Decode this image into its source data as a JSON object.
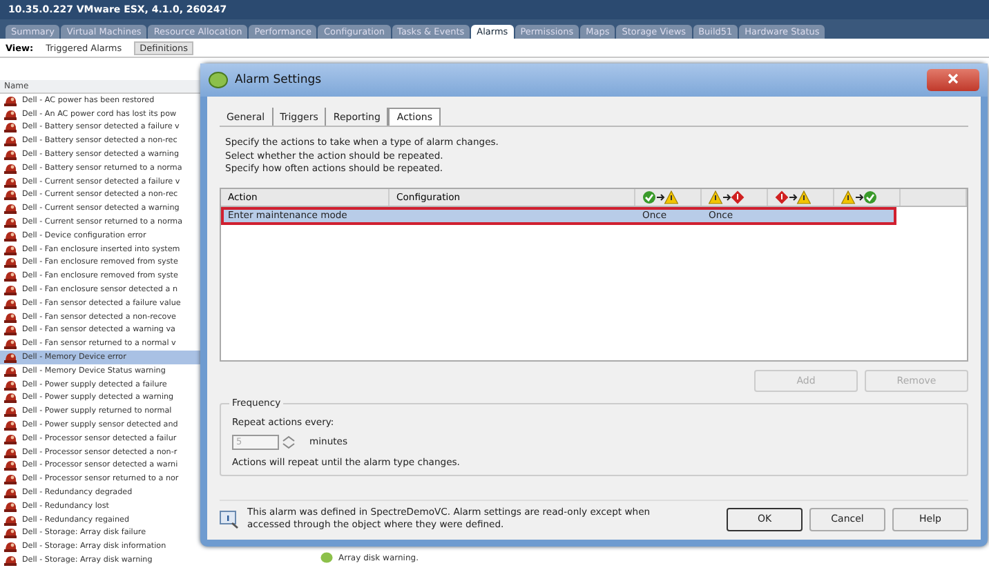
{
  "window": {
    "title": "10.35.0.227 VMware ESX, 4.1.0, 260247"
  },
  "tabs": [
    {
      "label": "Summary",
      "selected": false
    },
    {
      "label": "Virtual Machines",
      "selected": false
    },
    {
      "label": "Resource Allocation",
      "selected": false
    },
    {
      "label": "Performance",
      "selected": false
    },
    {
      "label": "Configuration",
      "selected": false
    },
    {
      "label": "Tasks & Events",
      "selected": false
    },
    {
      "label": "Alarms",
      "selected": true
    },
    {
      "label": "Permissions",
      "selected": false
    },
    {
      "label": "Maps",
      "selected": false
    },
    {
      "label": "Storage Views",
      "selected": false
    },
    {
      "label": "Build51",
      "selected": false
    },
    {
      "label": "Hardware Status",
      "selected": false
    }
  ],
  "view": {
    "label": "View:",
    "options": [
      {
        "label": "Triggered Alarms",
        "selected": false
      },
      {
        "label": "Definitions",
        "selected": true
      }
    ]
  },
  "alarm_list": {
    "column": "Name",
    "items": [
      {
        "name": "Dell - AC power has been restored",
        "selected": false
      },
      {
        "name": "Dell - An AC power cord has lost its pow",
        "selected": false
      },
      {
        "name": "Dell - Battery sensor detected a failure v",
        "selected": false
      },
      {
        "name": "Dell - Battery sensor detected a non-rec",
        "selected": false
      },
      {
        "name": "Dell - Battery sensor detected a warning",
        "selected": false
      },
      {
        "name": "Dell - Battery sensor returned to a norma",
        "selected": false
      },
      {
        "name": "Dell - Current sensor detected a failure v",
        "selected": false
      },
      {
        "name": "Dell - Current sensor detected a non-rec",
        "selected": false
      },
      {
        "name": "Dell - Current sensor detected a warning",
        "selected": false
      },
      {
        "name": "Dell - Current sensor returned to a norma",
        "selected": false
      },
      {
        "name": "Dell - Device configuration error",
        "selected": false
      },
      {
        "name": "Dell - Fan enclosure inserted into system",
        "selected": false
      },
      {
        "name": "Dell - Fan enclosure removed from syste",
        "selected": false
      },
      {
        "name": "Dell - Fan enclosure removed from syste",
        "selected": false
      },
      {
        "name": "Dell - Fan enclosure sensor detected a n",
        "selected": false
      },
      {
        "name": "Dell - Fan sensor detected a failure value",
        "selected": false
      },
      {
        "name": "Dell - Fan sensor detected a non-recove",
        "selected": false
      },
      {
        "name": "Dell - Fan sensor detected a warning va",
        "selected": false
      },
      {
        "name": "Dell - Fan sensor returned to a normal v",
        "selected": false
      },
      {
        "name": "Dell - Memory Device error",
        "selected": true
      },
      {
        "name": "Dell - Memory Device Status warning",
        "selected": false
      },
      {
        "name": "Dell - Power supply detected a failure",
        "selected": false
      },
      {
        "name": "Dell - Power supply detected a warning",
        "selected": false
      },
      {
        "name": "Dell - Power supply returned to normal",
        "selected": false
      },
      {
        "name": "Dell - Power supply sensor detected and",
        "selected": false
      },
      {
        "name": "Dell - Processor sensor detected a failur",
        "selected": false
      },
      {
        "name": "Dell - Processor sensor detected a non-r",
        "selected": false
      },
      {
        "name": "Dell - Processor sensor detected a warni",
        "selected": false
      },
      {
        "name": "Dell - Processor sensor returned to a nor",
        "selected": false
      },
      {
        "name": "Dell - Redundancy degraded",
        "selected": false
      },
      {
        "name": "Dell - Redundancy lost",
        "selected": false
      },
      {
        "name": "Dell - Redundancy regained",
        "selected": false
      },
      {
        "name": "Dell - Storage: Array disk failure",
        "selected": false
      },
      {
        "name": "Dell - Storage: Array disk information",
        "selected": false
      },
      {
        "name": "Dell - Storage: Array disk warning",
        "selected": false
      }
    ]
  },
  "detail_behind": {
    "text": "Array disk warning."
  },
  "dialog": {
    "title": "Alarm Settings",
    "tabs": [
      {
        "label": "General",
        "selected": false
      },
      {
        "label": "Triggers",
        "selected": false
      },
      {
        "label": "Reporting",
        "selected": false
      },
      {
        "label": "Actions",
        "selected": true
      }
    ],
    "instructions": [
      "Specify the actions to take when a type of alarm changes.",
      "Select whether the action should be repeated.",
      "Specify how often actions should be repeated."
    ],
    "table": {
      "columns": [
        "Action",
        "Configuration"
      ],
      "rows": [
        {
          "action": "Enter maintenance mode",
          "repeats": [
            "Once",
            "Once"
          ],
          "selected": true
        }
      ]
    },
    "buttons": [
      {
        "label": "Add",
        "disabled": true
      },
      {
        "label": "Remove",
        "disabled": true
      }
    ],
    "frequency": {
      "title": "Frequency",
      "label": "Repeat actions every:",
      "value": "5",
      "disabled": true,
      "unit": "minutes",
      "note": "Actions will repeat until the alarm type changes."
    },
    "footer": {
      "message": "This alarm was defined in SpectreDemoVC. Alarm settings are read-only except when accessed through the object where they were defined.",
      "buttons": [
        "OK",
        "Cancel",
        "Help"
      ]
    }
  }
}
